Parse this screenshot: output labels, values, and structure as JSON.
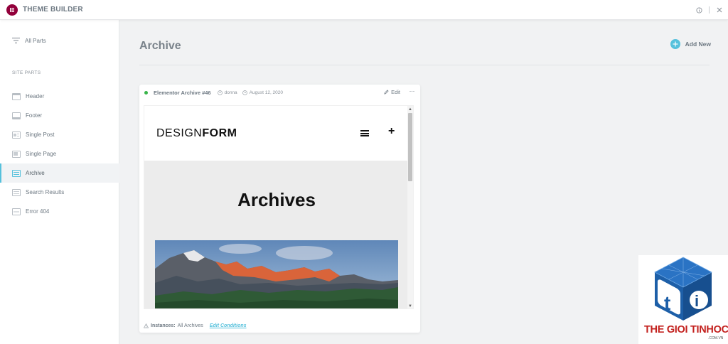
{
  "app": {
    "title": "THEME BUILDER"
  },
  "sidebar": {
    "all_parts_label": "All Parts",
    "section_title": "SITE PARTS",
    "items": [
      {
        "label": "Header",
        "icon": "header-template-icon"
      },
      {
        "label": "Footer",
        "icon": "footer-template-icon"
      },
      {
        "label": "Single Post",
        "icon": "single-post-template-icon"
      },
      {
        "label": "Single Page",
        "icon": "single-page-template-icon"
      },
      {
        "label": "Archive",
        "icon": "archive-template-icon",
        "active": true
      },
      {
        "label": "Search Results",
        "icon": "search-results-template-icon"
      },
      {
        "label": "Error 404",
        "icon": "error-404-template-icon"
      }
    ]
  },
  "main": {
    "title": "Archive",
    "add_new_label": "Add New"
  },
  "card": {
    "title": "Elementor Archive #46",
    "author": "donna",
    "date": "August 12, 2020",
    "edit_label": "Edit",
    "more_label": "···",
    "status_color": "#39b54a",
    "instances_label": "Instances:",
    "instances_value": "All Archives",
    "edit_conditions_label": "Edit Conditions"
  },
  "preview": {
    "brand_light": "DESIGN",
    "brand_bold": "FORM",
    "plus": "+",
    "heading": "Archives"
  },
  "watermark": {
    "text": "THE GIOI TINHOC",
    "sub": ".COM.VN"
  },
  "colors": {
    "accent": "#56c1dc",
    "brand": "#92003b",
    "watermark_red": "#c3211e",
    "watermark_blue": "#1f5fa6"
  }
}
